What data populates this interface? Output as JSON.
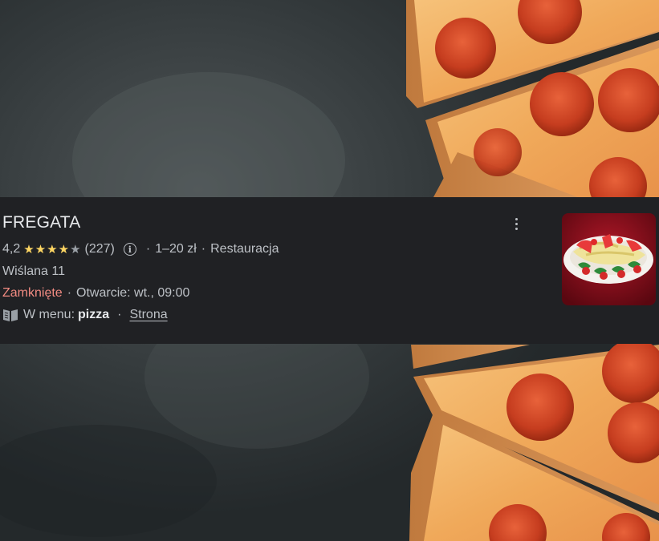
{
  "business": {
    "name": "FREGATA",
    "rating": "4,2",
    "stars_value": 4.2,
    "review_count": "(227)",
    "price_range": "1–20 zł",
    "category": "Restauracja",
    "address": "Wiślana 11",
    "status": "Zamknięte",
    "opening": "Otwarcie: wt., 09:00",
    "menu_prefix": "W menu:",
    "menu_item": "pizza",
    "website_link": "Strona"
  },
  "separators": {
    "dot": "·"
  },
  "colors": {
    "card_bg": "#202124",
    "closed_red": "#f28b82",
    "star_gold": "#fdd663"
  },
  "icons": {
    "info": "info-icon",
    "more": "more-vert-icon",
    "menu": "menu-book-icon"
  }
}
